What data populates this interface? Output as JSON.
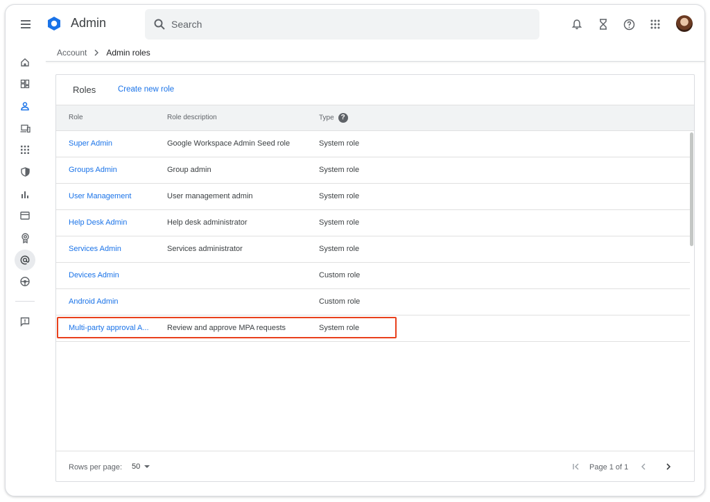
{
  "app": {
    "title": "Admin"
  },
  "search": {
    "placeholder": "Search"
  },
  "top_icons": [
    "notifications-icon",
    "hourglass-icon",
    "help-icon",
    "apps-grid-icon"
  ],
  "rail": [
    "home-icon",
    "dashboard-icon",
    "directory-icon",
    "devices-icon",
    "apps-icon",
    "security-icon",
    "reporting-icon",
    "billing-icon",
    "account-icon",
    "rules-icon",
    "storage-icon",
    "feedback-icon"
  ],
  "breadcrumb": {
    "parent": "Account",
    "current": "Admin roles"
  },
  "card": {
    "title": "Roles",
    "create_label": "Create new role"
  },
  "table": {
    "headers": {
      "role": "Role",
      "description": "Role description",
      "type": "Type"
    },
    "rows": [
      {
        "role": "Super Admin",
        "description": "Google Workspace Admin Seed role",
        "type": "System role"
      },
      {
        "role": "Groups Admin",
        "description": "Group admin",
        "type": "System role"
      },
      {
        "role": "User Management",
        "description": "User management admin",
        "type": "System role"
      },
      {
        "role": "Help Desk Admin",
        "description": "Help desk administrator",
        "type": "System role"
      },
      {
        "role": "Services Admin",
        "description": "Services administrator",
        "type": "System role"
      },
      {
        "role": "Devices Admin",
        "description": "",
        "type": "Custom role"
      },
      {
        "role": "Android Admin",
        "description": "",
        "type": "Custom role"
      },
      {
        "role": "Multi-party approval A...",
        "description": "Review and approve MPA requests",
        "type": "System role"
      }
    ],
    "highlighted_row": 7
  },
  "footer": {
    "rows_per_page_label": "Rows per page:",
    "rows_per_page_value": "50",
    "page_text": "Page 1 of 1"
  },
  "colors": {
    "accent": "#1a73e8",
    "highlight": "#e8401c",
    "logo": "#1a73e8"
  }
}
